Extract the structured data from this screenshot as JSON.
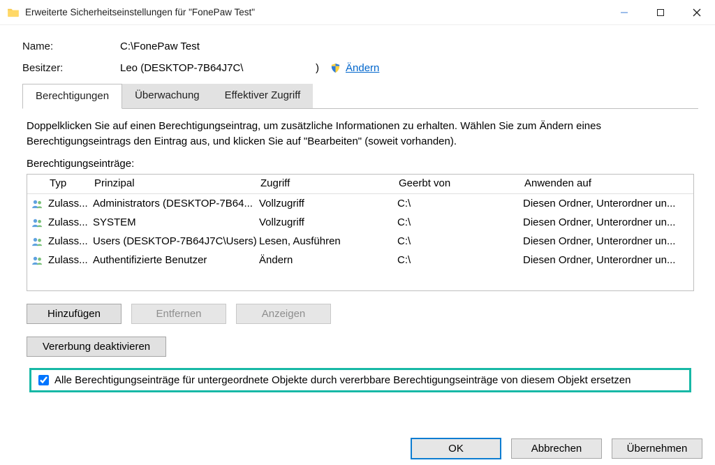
{
  "window": {
    "title": "Erweiterte Sicherheitseinstellungen für \"FonePaw Test\""
  },
  "info": {
    "name_label": "Name:",
    "name_value": "C:\\FonePaw Test",
    "owner_label": "Besitzer:",
    "owner_value": "Leo (DESKTOP-7B64J7C\\",
    "owner_close": ")",
    "change_link": "Ändern"
  },
  "tabs": {
    "permissions": "Berechtigungen",
    "auditing": "Überwachung",
    "effective": "Effektiver Zugriff"
  },
  "instructions": "Doppelklicken Sie auf einen Berechtigungseintrag, um zusätzliche Informationen zu erhalten. Wählen Sie zum Ändern eines Berechtigungseintrags den Eintrag aus, und klicken Sie auf \"Bearbeiten\" (soweit vorhanden).",
  "entries_label": "Berechtigungseinträge:",
  "headers": {
    "type": "Typ",
    "principal": "Prinzipal",
    "access": "Zugriff",
    "inherited": "Geerbt von",
    "applies": "Anwenden auf"
  },
  "rows": [
    {
      "type": "Zulass...",
      "principal": "Administrators (DESKTOP-7B64...",
      "access": "Vollzugriff",
      "inherited": "C:\\",
      "applies": "Diesen Ordner, Unterordner un..."
    },
    {
      "type": "Zulass...",
      "principal": "SYSTEM",
      "access": "Vollzugriff",
      "inherited": "C:\\",
      "applies": "Diesen Ordner, Unterordner un..."
    },
    {
      "type": "Zulass...",
      "principal": "Users (DESKTOP-7B64J7C\\Users)",
      "access": "Lesen, Ausführen",
      "inherited": "C:\\",
      "applies": "Diesen Ordner, Unterordner un..."
    },
    {
      "type": "Zulass...",
      "principal": "Authentifizierte Benutzer",
      "access": "Ändern",
      "inherited": "C:\\",
      "applies": "Diesen Ordner, Unterordner un..."
    }
  ],
  "buttons": {
    "add": "Hinzufügen",
    "remove": "Entfernen",
    "view": "Anzeigen",
    "disable_inh": "Vererbung deaktivieren",
    "ok": "OK",
    "cancel": "Abbrechen",
    "apply": "Übernehmen"
  },
  "checkbox": {
    "replace": "Alle Berechtigungseinträge für untergeordnete Objekte durch vererbbare Berechtigungseinträge von diesem Objekt ersetzen"
  }
}
